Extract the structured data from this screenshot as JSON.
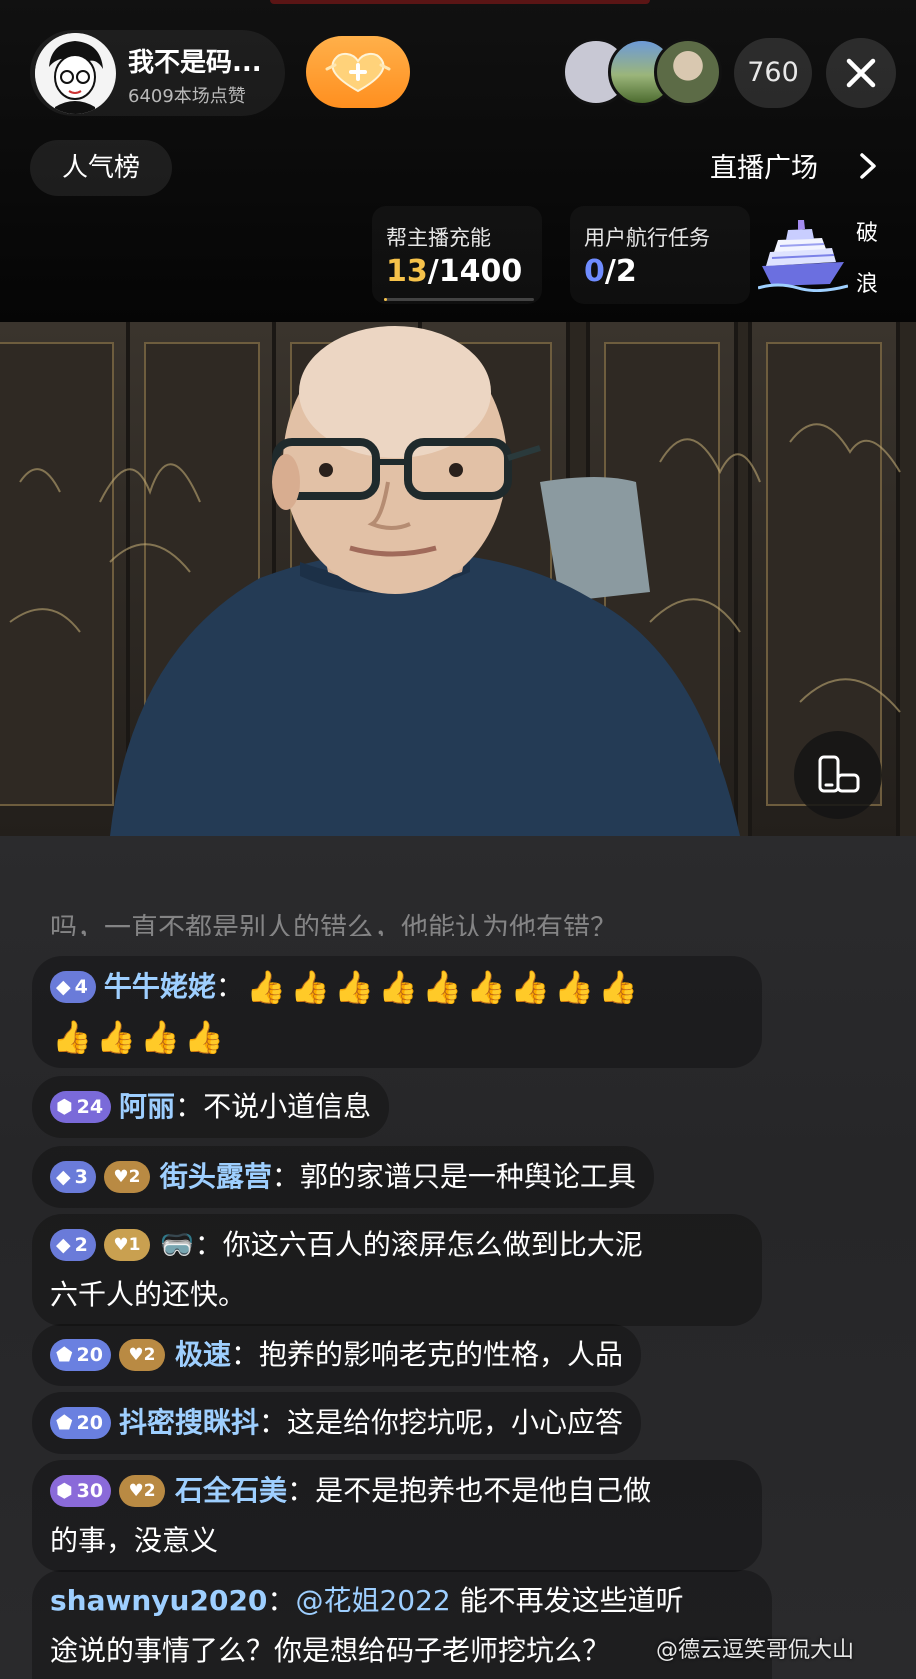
{
  "host": {
    "name": "我不是码...",
    "likes": "6409本场点赞"
  },
  "viewer_count": "760",
  "rank_label": "人气榜",
  "plaza_label": "直播广场",
  "tasks": {
    "charge": {
      "title": "帮主播充能",
      "current": "13",
      "total": "/1400",
      "progress_fraction": 0.0093
    },
    "voyage": {
      "title": "用户航行任务",
      "current": "0",
      "total": "/2"
    },
    "ship_label": {
      "top": "破",
      "bottom": "浪"
    }
  },
  "chat": {
    "faded_line": "吗，一直不都是别人的错么，他能认为他有错？",
    "messages": [
      {
        "level": "4",
        "badge_type": "diamond",
        "user": "牛牛姥姥",
        "text": "",
        "emoji_count": 13
      },
      {
        "level": "24",
        "badge_type": "hex",
        "user": "阿丽",
        "text": "不说小道信息"
      },
      {
        "level": "3",
        "badge_type": "diamond",
        "fan_level": "2",
        "user": "街头露营",
        "text": "郭的家谱只是一种舆论工具"
      },
      {
        "level": "2",
        "badge_type": "diamond",
        "fan_level": "1",
        "user": "🥽",
        "text_line1": "你这六百人的滚屏怎么做到比大泥",
        "text_line2": "六千人的还快。"
      },
      {
        "level": "20",
        "badge_type": "pent",
        "fan_level": "2",
        "user": "极速",
        "text": "抱养的影响老克的性格，人品"
      },
      {
        "level": "20",
        "badge_type": "pent",
        "user": "抖密搜眯抖",
        "text": "这是给你挖坑呢，小心应答"
      },
      {
        "level": "30",
        "badge_type": "hex",
        "fan_level": "2",
        "user": "石全石美",
        "text_line1": "是不是抱养也不是他自己做",
        "text_line2": "的事，没意义"
      },
      {
        "user": "shawnyu2020",
        "mention": "@花姐2022",
        "text_line1": "能不再发这些道听",
        "text_line2": "途说的事情了么？你是想给码子老师挖坑么？"
      }
    ]
  },
  "watermark": "@德云逗笑哥侃大山",
  "colors": {
    "accent_orange": "#ff9f2e",
    "username_blue": "#9ecfff",
    "progress_gold": "#f6c24a",
    "voyage_blue": "#6f8cff"
  }
}
